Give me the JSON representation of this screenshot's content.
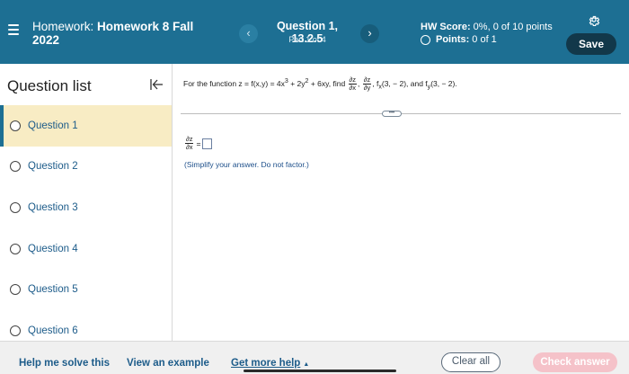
{
  "header": {
    "title_prefix": "Homework: ",
    "title_strong": "Homework 8 Fall 2022",
    "question_title": "Question 1, 13.2.5",
    "question_part": "Part 1 of 4",
    "prev_glyph": "‹",
    "next_glyph": "›",
    "hw_score_label": "HW Score:",
    "hw_score_value": " 0%, 0 of 10 points",
    "points_label": "Points:",
    "points_value": "0 of 1",
    "save_label": "Save",
    "icons": {
      "menu": "hamburger-menu-icon",
      "settings": "gear-icon"
    }
  },
  "sidebar": {
    "title": "Question list",
    "collapse_icon": "collapse-left-icon",
    "items": [
      {
        "label": "Question 1"
      },
      {
        "label": "Question 2"
      },
      {
        "label": "Question 3"
      },
      {
        "label": "Question 4"
      },
      {
        "label": "Question 5"
      },
      {
        "label": "Question 6"
      }
    ]
  },
  "main": {
    "problem": {
      "lead": "For the function z = f(x,y) = 4x",
      "exp1": "3",
      "mid1": " + 2y",
      "exp2": "2",
      "mid2": " + 6xy, find ",
      "d1_num": "∂z",
      "d1_den": "∂x",
      "d2_num": "∂z",
      "d2_den": "∂y",
      "sep": ", ",
      "fx": ", f",
      "fx_sub": "x",
      "fx_args": "(3, − 2), and f",
      "fy_sub": "y",
      "fy_args": "(3, − 2)."
    },
    "more_pill": "•••",
    "answer": {
      "num": "∂z",
      "den": "∂x",
      "eq": "="
    },
    "hint": "(Simplify your answer. Do not factor.)"
  },
  "footer": {
    "help_label": "Help me solve this",
    "example_label": "View an example",
    "more_help_label": "Get more help",
    "more_help_caret": "▲",
    "clear_label": "Clear all",
    "check_label": "Check answer"
  },
  "colors": {
    "header_bg": "#1d6f93",
    "save_bg": "#12384a",
    "active_item_bg": "#f8ecc4",
    "link": "#1d5c8a",
    "check_disabled": "#f5c2c9"
  }
}
